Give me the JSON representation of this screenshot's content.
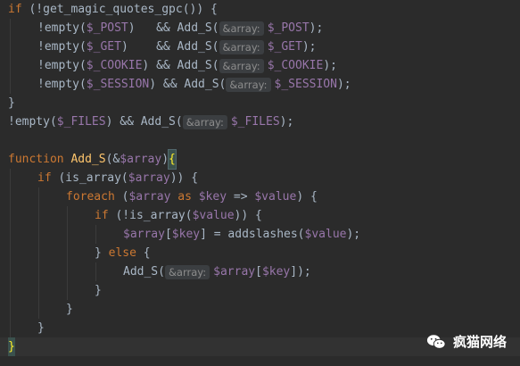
{
  "code": {
    "l1": {
      "a": "if",
      "b": " (!",
      "c": "get_magic_quotes_gpc",
      "d": "()) {"
    },
    "l2": {
      "a": "!empty(",
      "b": "$_POST",
      "c": ")   && Add_S(",
      "hint": "&array:",
      "d": "$_POST",
      "e": ");"
    },
    "l3": {
      "a": "!empty(",
      "b": "$_GET",
      "c": ")    && Add_S(",
      "hint": "&array:",
      "d": "$_GET",
      "e": ");"
    },
    "l4": {
      "a": "!empty(",
      "b": "$_COOKIE",
      "c": ") && Add_S(",
      "hint": "&array:",
      "d": "$_COOKIE",
      "e": ");"
    },
    "l5": {
      "a": "!empty(",
      "b": "$_SESSION",
      "c": ") && Add_S(",
      "hint": "&array:",
      "d": "$_SESSION",
      "e": ");"
    },
    "l6": {
      "a": "}"
    },
    "l7": {
      "a": "!empty(",
      "b": "$_FILES",
      "c": ") && Add_S(",
      "hint": "&array:",
      "d": "$_FILES",
      "e": ");"
    },
    "l9": {
      "a": "function",
      "b": " Add_S",
      "c": "(&",
      "d": "$array",
      "e": ")",
      "f": "{"
    },
    "l10": {
      "a": "if",
      "b": " (is_array(",
      "c": "$array",
      "d": ")) {"
    },
    "l11": {
      "a": "foreach",
      "b": " (",
      "c": "$array",
      "d": " as ",
      "e": "$key",
      "f": " => ",
      "g": "$value",
      "h": ") {"
    },
    "l12": {
      "a": "if",
      "b": " (!is_array(",
      "c": "$value",
      "d": ")) {"
    },
    "l13": {
      "a": "$array",
      "b": "[",
      "c": "$key",
      "d": "] = addslashes(",
      "e": "$value",
      "f": ");"
    },
    "l14": {
      "a": "} ",
      "b": "else",
      "c": " {"
    },
    "l15": {
      "a": "Add_S(",
      "hint": "&array:",
      "b": "$array",
      "c": "[",
      "d": "$key",
      "e": "]);"
    },
    "l16": {
      "a": "}"
    },
    "l17": {
      "a": "}"
    },
    "l18": {
      "a": "}"
    },
    "l19": {
      "a": "}"
    }
  },
  "watermark": {
    "text": "疯猫网络",
    "icon": "wechat-icon"
  },
  "colors": {
    "background": "#2b2b2b",
    "keyword": "#cc7832",
    "variable": "#9876aa",
    "function": "#ffc66d",
    "text": "#a9b7c6"
  }
}
